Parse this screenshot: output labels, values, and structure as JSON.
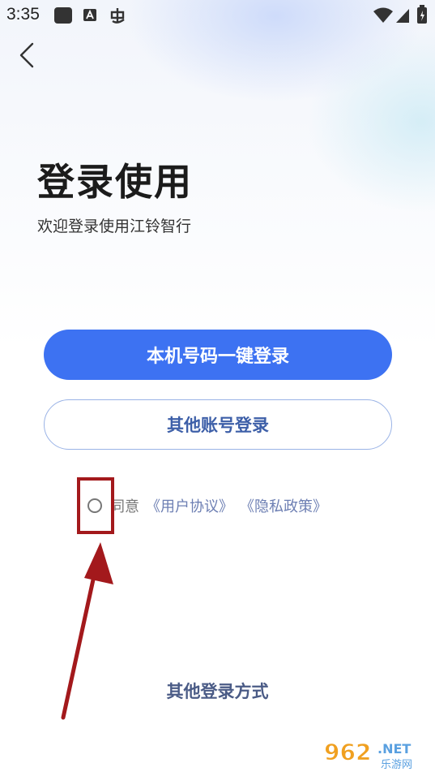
{
  "status_bar": {
    "time": "3:35"
  },
  "header": {
    "title": "登录使用",
    "subtitle": "欢迎登录使用江铃智行"
  },
  "buttons": {
    "one_click_login": "本机号码一键登录",
    "other_account_login": "其他账号登录"
  },
  "agreement": {
    "agree_label": "同意",
    "user_agreement": "《用户协议》",
    "privacy_policy": "《隐私政策》"
  },
  "footer": {
    "other_methods": "其他登录方式"
  },
  "watermark": {
    "brand": "962",
    "suffix": ".NET",
    "site": "乐游网"
  },
  "colors": {
    "primary": "#3d72f2",
    "annotation": "#a3191c"
  },
  "icons": [
    "notification-square-icon",
    "a-badge-icon",
    "bug-icon",
    "wifi-icon",
    "signal-icon",
    "battery-icon",
    "back-chevron-icon",
    "radio-unchecked-icon"
  ]
}
